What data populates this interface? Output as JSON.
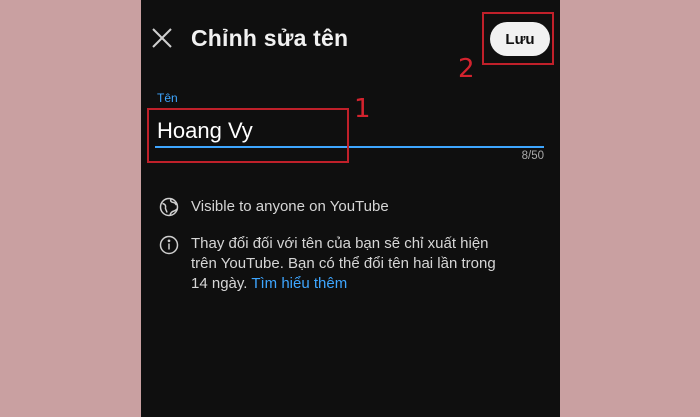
{
  "header": {
    "close_icon": "close-icon",
    "title": "Chỉnh sửa tên",
    "save_label": "Lưu"
  },
  "name_field": {
    "label": "Tên",
    "value": "Hoang Vy",
    "counter": "8/50"
  },
  "visibility": {
    "icon": "globe-icon",
    "text": "Visible to anyone on YouTube"
  },
  "info": {
    "icon": "info-icon",
    "line1": "Thay đổi đối với tên của bạn sẽ chỉ xuất hiện",
    "line2": "trên YouTube. Bạn có thể đổi tên hai lần trong",
    "line3": "14 ngày.",
    "link_text": "Tìm hiểu thêm"
  },
  "annotations": {
    "marker_1": "1",
    "marker_2": "2"
  },
  "colors": {
    "page_background": "#c9a0a1",
    "screen_background": "#0f0f0f",
    "accent_blue": "#3ea6ff",
    "annotation_red": "#c0202a",
    "save_button_bg": "#f1f1f1"
  }
}
